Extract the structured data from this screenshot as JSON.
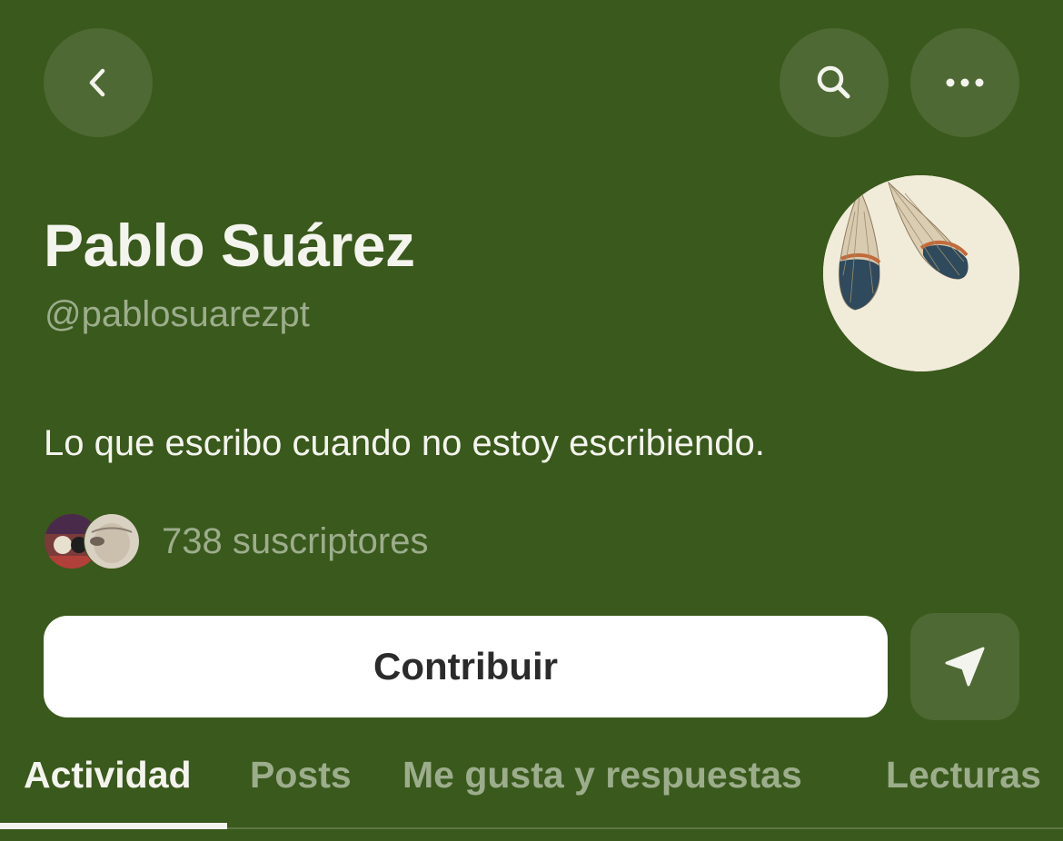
{
  "header": {
    "back_icon": "chevron-left-icon",
    "search_icon": "search-icon",
    "more_icon": "more-horizontal-icon"
  },
  "profile": {
    "name": "Pablo Suárez",
    "handle": "@pablosuarezpt",
    "bio": "Lo que escribo cuando no estoy escribiendo.",
    "subscribers": "738 suscriptores"
  },
  "actions": {
    "contribute_label": "Contribuir",
    "share_icon": "send-icon"
  },
  "tabs": [
    {
      "label": "Actividad",
      "active": true
    },
    {
      "label": "Posts",
      "active": false
    },
    {
      "label": "Me gusta y respuestas",
      "active": false
    },
    {
      "label": "Lecturas",
      "active": false
    }
  ],
  "colors": {
    "background": "#3a591c",
    "primary_text": "#f4f4ee",
    "secondary_text": "#9cad8c",
    "button_bg": "#ffffff"
  }
}
